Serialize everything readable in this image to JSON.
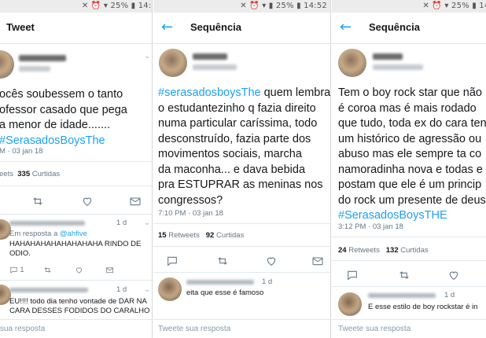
{
  "status_bar": {
    "panel1": "✕ ⏰ ▾ 25% ▮ 14:5",
    "panel2": "✕ ⏰ ▾ ▮ 25% ▮ 14:52",
    "panel3": "✕ ⏰ ▾ 25% ▮ 14:"
  },
  "panel1": {
    "title": "Tweet",
    "tweet_lines": [
      "ocês soubessem o tanto",
      "ofessor casado que pega",
      "a menor de idade......."
    ],
    "hashtag": "SerasadosBoysThe",
    "meta": "M · 03 jan 18",
    "stats_prefix": "eets",
    "curtidas_count": "335",
    "curtidas_label": "Curtidas",
    "reply1": {
      "time": "1 d",
      "in_reply_to": "Em resposta a",
      "mention": "@ahfive",
      "lines": [
        "HAHAHAHAHAHAHAHAHA RINDO DE",
        "ODIO."
      ],
      "reply_count": "1"
    },
    "reply2": {
      "time": "1 d",
      "lines": [
        "EU!!!! todo dia tenho vontade de DAR NA",
        "CARA DESSES FODIDOS DO CARALHO"
      ]
    },
    "composer": "sua resposta"
  },
  "panel2": {
    "title": "Sequência",
    "hashtag": "#serasadosboysThe",
    "first_line_rest": " quem lembra",
    "tweet_lines": [
      "o estudantezinho q fazia direito",
      "numa particular caríssima, todo",
      "desconstruído, fazia parte dos",
      "movimentos sociais, marcha",
      "da maconha... e dava bebida",
      "pra ESTUPRAR as meninas nos",
      "congressos?"
    ],
    "meta": "7:10 PM · 03 jan 18",
    "retweets_count": "15",
    "retweets_label": "Retweets",
    "curtidas_count": "92",
    "curtidas_label": "Curtidas",
    "reply1": {
      "time": "1 d",
      "text": "eita que esse é famoso"
    },
    "composer": "Tweete sua resposta"
  },
  "panel3": {
    "title": "Sequência",
    "tweet_lines": [
      "Tem o boy rock star que não",
      "é coroa mas é mais rodado",
      "que tudo, toda ex do cara ten",
      "um histórico de agressão ou",
      "abuso mas ele sempre ta co",
      "namoradinha nova e todas e",
      "postam que ele é um princip",
      "do rock um presente de deus"
    ],
    "hashtag": "#SerasadosBoysTHE",
    "meta": "3:12 PM · 03 jan 18",
    "retweets_count": "24",
    "retweets_label": "Retweets",
    "curtidas_count": "132",
    "curtidas_label": "Curtidas",
    "reply1": {
      "time": "1 d",
      "text": "E esse estilo de boy rockstar é in"
    },
    "composer": "Tweete sua resposta"
  },
  "colors": {
    "accent": "#1da1f2",
    "text": "#14171a",
    "muted": "#657786"
  }
}
